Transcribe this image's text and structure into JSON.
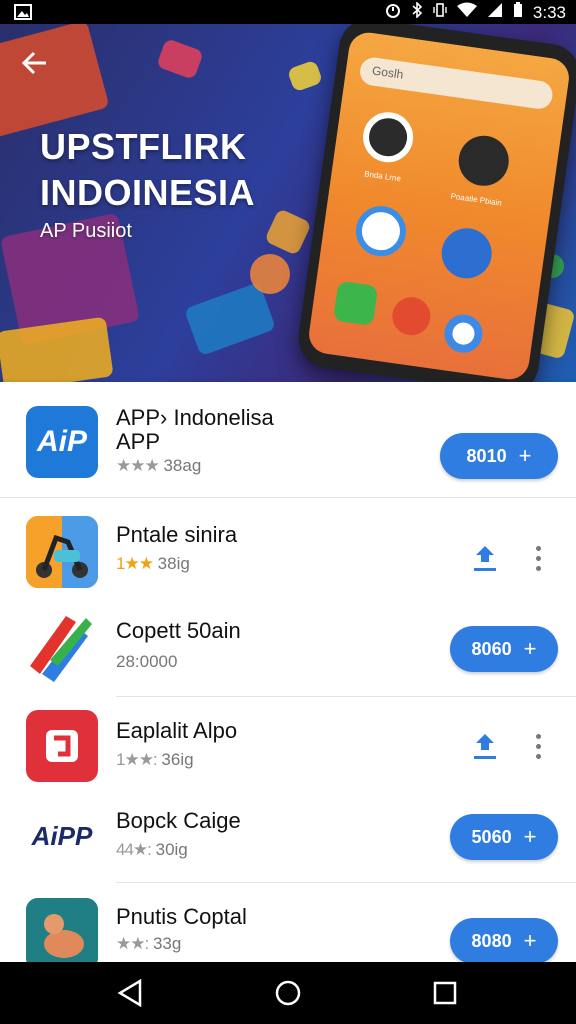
{
  "status_bar": {
    "time": "3:33",
    "icons": [
      "image-icon",
      "alarm-icon",
      "vibrate-icon",
      "wifi-icon",
      "signal-icon",
      "battery-icon"
    ]
  },
  "banner": {
    "title_line1": "UPSTFLIRK",
    "title_line2": "INDOINESIA",
    "subtitle": "AP Pusiiot",
    "phone_search": "Goslh",
    "phone_apps": [
      "Bnda Lrne",
      "Poaatle Pbiain"
    ]
  },
  "featured": {
    "name_line1": "APP› Indonelisa",
    "name_line2": "APP",
    "stars": "★★★",
    "meta": "38ag",
    "button_label": "8010",
    "button_plus": "+"
  },
  "apps": [
    {
      "name": "Pntale sinira",
      "stars": "1★★",
      "meta": "38ig",
      "action": "download"
    },
    {
      "name": "Copett 50ain",
      "stars": "",
      "meta": "28:0000",
      "action": "button",
      "button_label": "8060",
      "button_plus": "+"
    },
    {
      "name": "Eaplalit Alpo",
      "stars": "1★★:",
      "meta": "36ig",
      "action": "download"
    },
    {
      "name": "Bopck Caige",
      "stars": "44★:",
      "meta": "30ig",
      "action": "button",
      "button_label": "5060",
      "button_plus": "+"
    },
    {
      "name": "Pnutis Coptal",
      "stars": "★★:",
      "meta": "33g",
      "action": "button",
      "button_label": "8080",
      "button_plus": "+"
    }
  ],
  "icon_texts": {
    "featured_icon": "AiP",
    "bopck_icon": "AiPP"
  },
  "colors": {
    "accent": "#2f7de1",
    "star_gold": "#f2a20f",
    "red_icon": "#e0303a"
  }
}
